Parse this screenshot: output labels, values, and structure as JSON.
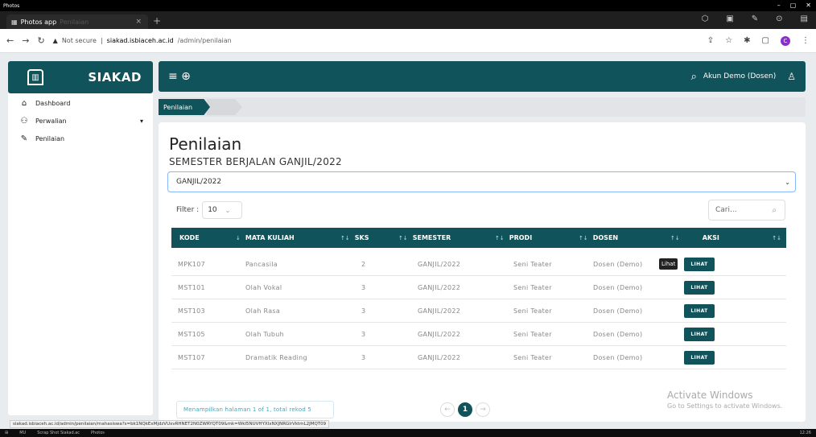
{
  "window": {
    "title": "Photos",
    "controls": [
      "–",
      "▢",
      "✕"
    ]
  },
  "browser": {
    "tab_title": "Photos app",
    "tab_subtitle": "Penilaian",
    "tab_close": "×",
    "new_tab": "+",
    "not_secure": "Not secure",
    "url_domain": "siakad.isbiaceh.ac.id",
    "url_path": "/admin/penilaian",
    "status_url": "siakad.isbiaceh.ac.id/admin/penilaian/mahasiswa?s=bk1NQkExMjdzVUxvRHNET2N0ZWRYQT09&mk=WkI5NUVHYXIxNXJNRGlrVktmL2JMQT09",
    "profile_initial": "C"
  },
  "app": {
    "brand": "SIAKAD",
    "user": "Akun Demo (Dosen)",
    "sidebar": [
      {
        "label": "Dashboard",
        "icon": "home-icon"
      },
      {
        "label": "Perwalian",
        "icon": "users-icon",
        "has_children": true
      },
      {
        "label": "Penilaian",
        "icon": "pencil-icon"
      }
    ],
    "breadcrumb": "Penilaian"
  },
  "content": {
    "title": "Penilaian",
    "subtitle": "SEMESTER BERJALAN GANJIL/2022",
    "semester_select": "GANJIL/2022",
    "filter_label": "Filter :",
    "filter_value": "10",
    "search_placeholder": "Cari...",
    "columns": [
      "KODE",
      "MATA KULIAH",
      "SKS",
      "SEMESTER",
      "PRODI",
      "DOSEN",
      "AKSI"
    ],
    "rows": [
      {
        "kode": "MPK107",
        "mata_kuliah": "Pancasila",
        "sks": "2",
        "semester": "GANJIL/2022",
        "prodi": "Seni Teater",
        "dosen": "Dosen (Demo)",
        "aksi": "LIHAT"
      },
      {
        "kode": "MST101",
        "mata_kuliah": "Olah Vokal",
        "sks": "3",
        "semester": "GANJIL/2022",
        "prodi": "Seni Teater",
        "dosen": "Dosen (Demo)",
        "aksi": "LIHAT"
      },
      {
        "kode": "MST103",
        "mata_kuliah": "Olah Rasa",
        "sks": "3",
        "semester": "GANJIL/2022",
        "prodi": "Seni Teater",
        "dosen": "Dosen (Demo)",
        "aksi": "LIHAT"
      },
      {
        "kode": "MST105",
        "mata_kuliah": "Olah Tubuh",
        "sks": "3",
        "semester": "GANJIL/2022",
        "prodi": "Seni Teater",
        "dosen": "Dosen (Demo)",
        "aksi": "LIHAT"
      },
      {
        "kode": "MST107",
        "mata_kuliah": "Dramatik Reading",
        "sks": "3",
        "semester": "GANJIL/2022",
        "prodi": "Seni Teater",
        "dosen": "Dosen (Demo)",
        "aksi": "LIHAT"
      }
    ],
    "tooltip": "Lihat",
    "pagination_info": "Menampilkan halaman 1 of 1, total rekod 5",
    "current_page": "1"
  },
  "watermark": {
    "line1": "Activate Windows",
    "line2": "Go to Settings to activate Windows."
  },
  "taskbar": {
    "items": [
      "MU",
      "Scrap Shot Siakad.ac",
      "Photos"
    ],
    "clock": "12:26"
  },
  "colors": {
    "primary": "#11535a",
    "focus_border": "#86b7fe",
    "info_text": "#4ba3b5"
  }
}
